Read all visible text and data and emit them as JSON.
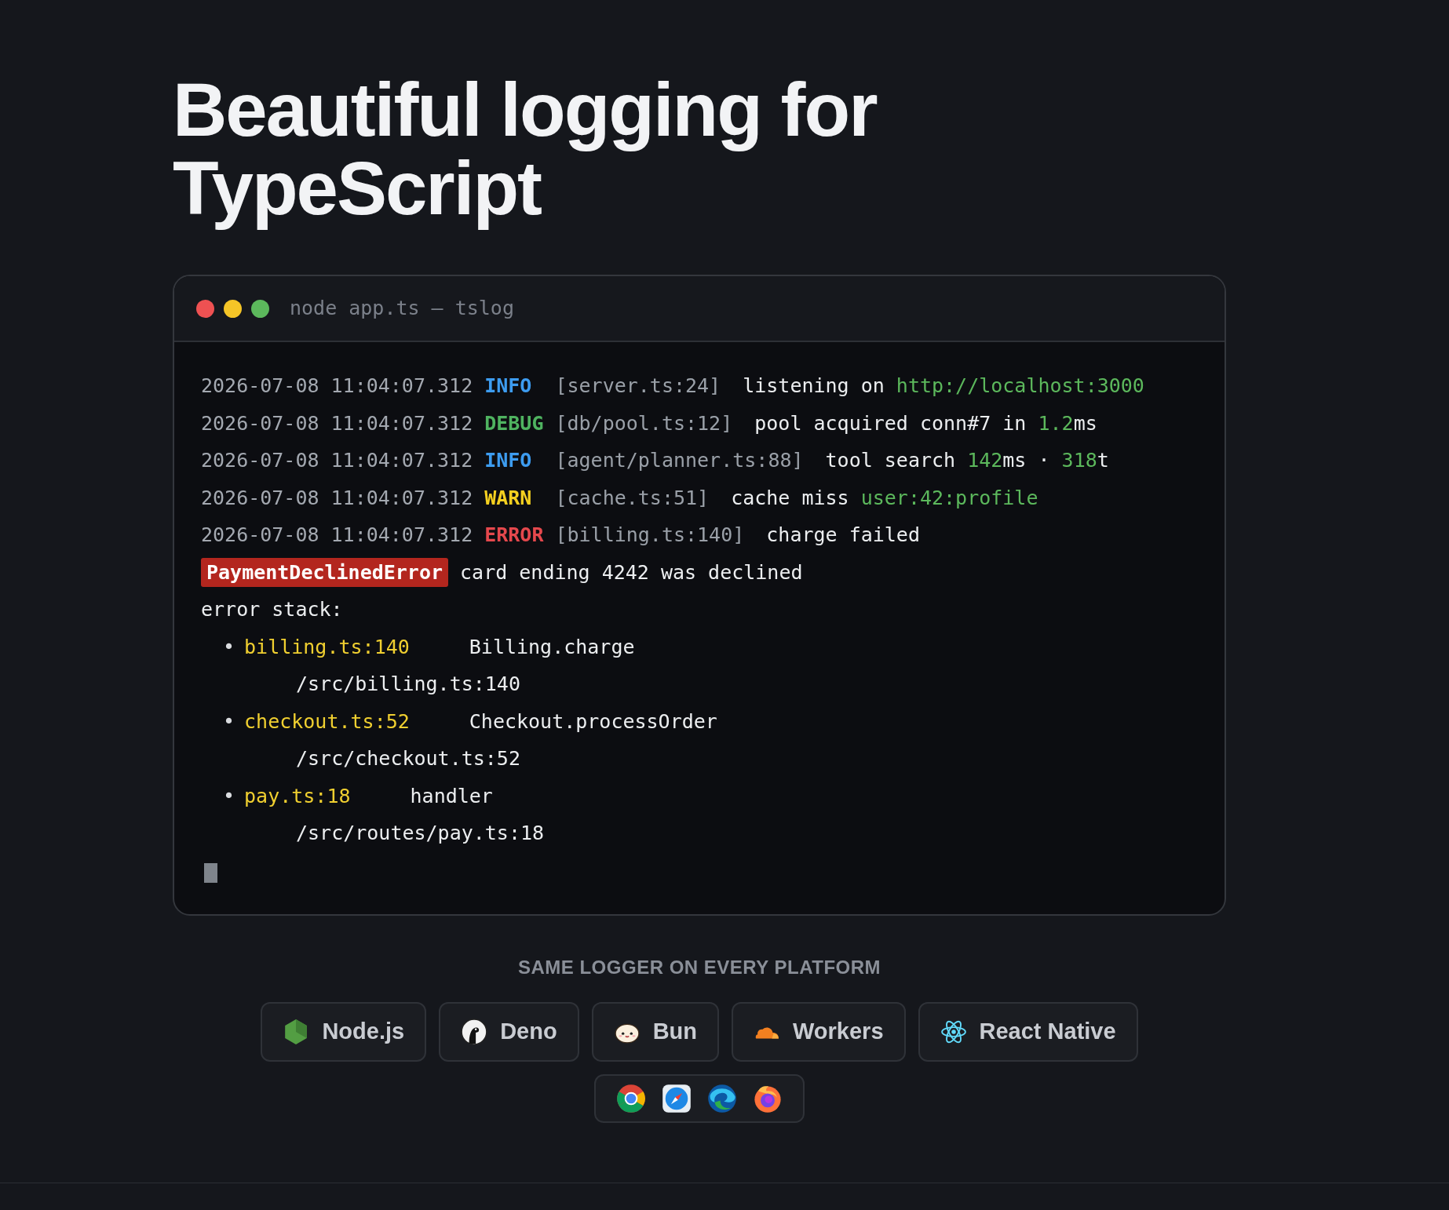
{
  "heading": "Beautiful logging for TypeScript",
  "terminal": {
    "title": "node app.ts — tslog",
    "lines": [
      {
        "segments": [
          {
            "kind": "timestamp",
            "text": "2026-07-08 11:04:07.312"
          },
          {
            "kind": "info",
            "text": "INFO "
          },
          {
            "kind": "source",
            "text": "[server.ts:24]"
          },
          {
            "kind": "message",
            "text": "listening on "
          },
          {
            "kind": "value",
            "text": "http://localhost:3000"
          }
        ]
      },
      {
        "segments": [
          {
            "kind": "timestamp",
            "text": "2026-07-08 11:04:07.312"
          },
          {
            "kind": "debug",
            "text": "DEBUG"
          },
          {
            "kind": "source",
            "text": "[db/pool.ts:12]"
          },
          {
            "kind": "message",
            "text": "pool acquired conn#7 in "
          },
          {
            "kind": "value",
            "text": "1.2"
          },
          {
            "kind": "message",
            "text": "ms"
          }
        ]
      },
      {
        "segments": [
          {
            "kind": "timestamp",
            "text": "2026-07-08 11:04:07.312"
          },
          {
            "kind": "info",
            "text": "INFO "
          },
          {
            "kind": "source",
            "text": "[agent/planner.ts:88]"
          },
          {
            "kind": "message",
            "text": "tool search "
          },
          {
            "kind": "value",
            "text": "142"
          },
          {
            "kind": "message",
            "text": "ms · "
          },
          {
            "kind": "value",
            "text": "318"
          },
          {
            "kind": "message",
            "text": "t"
          }
        ]
      },
      {
        "segments": [
          {
            "kind": "timestamp",
            "text": "2026-07-08 11:04:07.312"
          },
          {
            "kind": "warn",
            "text": "WARN "
          },
          {
            "kind": "source",
            "text": "[cache.ts:51]"
          },
          {
            "kind": "message",
            "text": "cache miss "
          },
          {
            "kind": "value",
            "text": "user:42:profile"
          }
        ]
      },
      {
        "segments": [
          {
            "kind": "timestamp",
            "text": "2026-07-08 11:04:07.312"
          },
          {
            "kind": "error",
            "text": "ERROR"
          },
          {
            "kind": "source",
            "text": "[billing.ts:140]"
          },
          {
            "kind": "message",
            "text": "charge failed"
          }
        ]
      },
      {
        "segments": [
          {
            "kind": "badge",
            "text": "PaymentDeclinedError"
          },
          {
            "kind": "message",
            "text": "card ending 4242 was declined"
          }
        ]
      }
    ],
    "stack_label": "error stack:",
    "stack": [
      {
        "bullet": "•",
        "location": "billing.ts:140",
        "function": "Billing.charge",
        "path": "/src/billing.ts:140"
      },
      {
        "bullet": "•",
        "location": "checkout.ts:52",
        "function": "Checkout.processOrder",
        "path": "/src/checkout.ts:52"
      },
      {
        "bullet": "•",
        "location": "pay.ts:18",
        "function": "handler",
        "path": "/src/routes/pay.ts:18"
      }
    ]
  },
  "platforms": {
    "caption": "SAME LOGGER ON EVERY PLATFORM",
    "items": [
      {
        "kind": "node",
        "label": "Node.js"
      },
      {
        "kind": "deno",
        "label": "Deno"
      },
      {
        "kind": "bun",
        "label": "Bun"
      },
      {
        "kind": "workers",
        "label": "Workers"
      },
      {
        "kind": "react",
        "label": "React Native"
      }
    ],
    "browsers": [
      {
        "kind": "chrome"
      },
      {
        "kind": "safari"
      },
      {
        "kind": "edge"
      },
      {
        "kind": "firefox"
      }
    ]
  }
}
